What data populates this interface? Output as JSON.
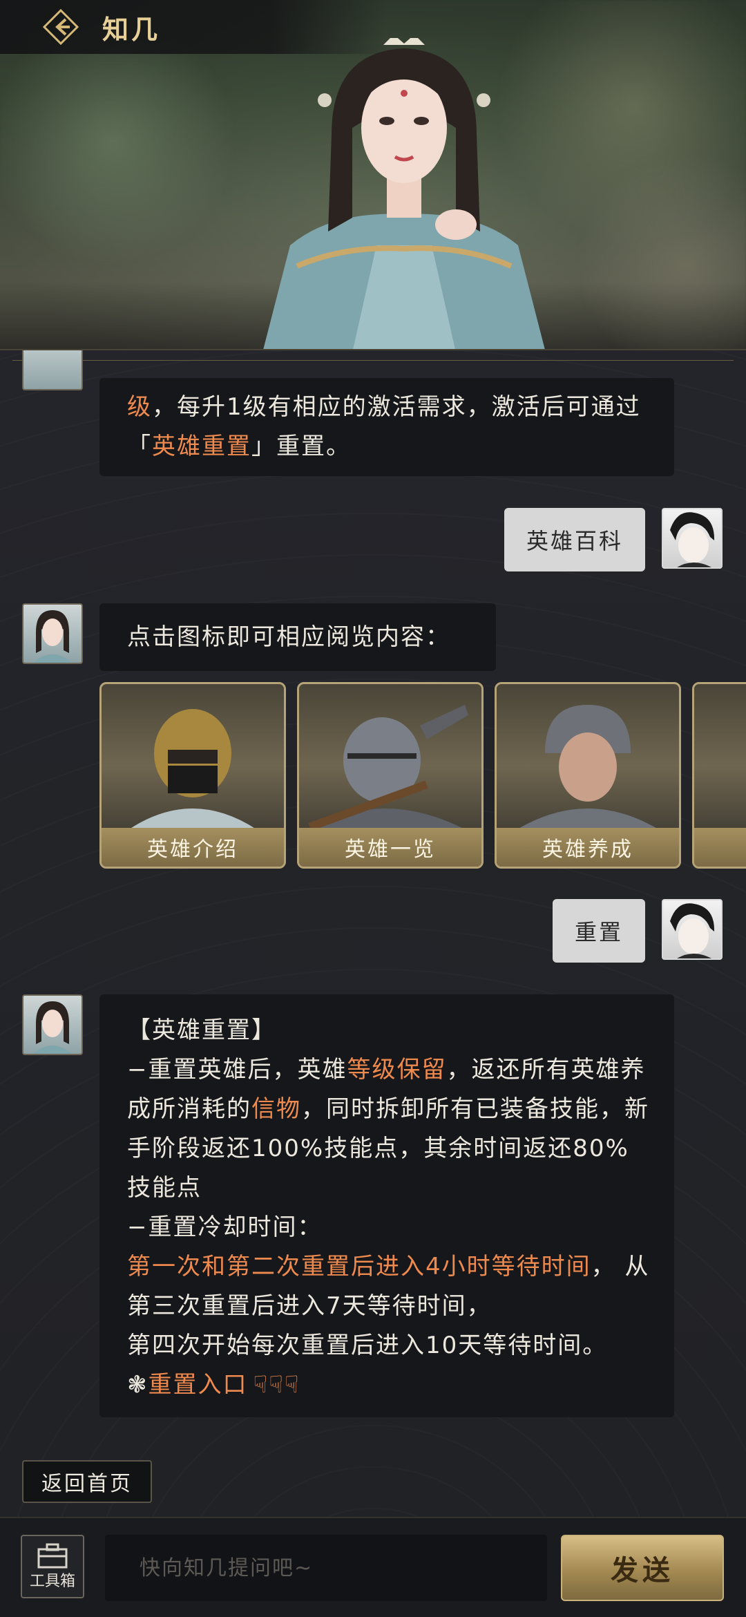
{
  "header": {
    "title": "知几",
    "back_icon": "back-arrow-icon"
  },
  "chat": {
    "bot_msg_1": {
      "parts": [
        {
          "text": "级",
          "hl": true
        },
        {
          "text": "，每升1级有相应的激活需求，激活后可通过「",
          "hl": false
        },
        {
          "text": "英雄重置",
          "hl": true
        },
        {
          "text": "」重置。",
          "hl": false
        }
      ]
    },
    "user_msg_1": "英雄百科",
    "bot_msg_2": "点击图标即可相应阅览内容：",
    "cards": [
      {
        "label": "英雄介绍"
      },
      {
        "label": "英雄一览"
      },
      {
        "label": "英雄养成"
      }
    ],
    "user_msg_2": "重置",
    "bot_msg_3": {
      "heading": "【英雄重置】",
      "line1_a": "−重置英雄后，英雄",
      "line1_hl": "等级保留",
      "line1_b": "，返还所有英雄养成所消耗的",
      "line1_hl2": "信物",
      "line1_c": "，同时拆卸所有已装备技能，新手阶段返还100%技能点，其余时间返还80%技能点",
      "line2": "−重置冷却时间：",
      "line3_hl": "第一次和第二次重置后进入4小时等待时间",
      "line3_b": "， 从第三次重置后进入7天等待时间，",
      "line4": "第四次开始每次重置后进入10天等待时间。",
      "link_prefix": "❃",
      "link_text": "重置入口",
      "link_icons": "☟☟☟"
    }
  },
  "home_button": "返回首页",
  "bottom": {
    "toolbox_label": "工具箱",
    "input_placeholder": "快向知几提问吧~",
    "send_label": "发送"
  },
  "colors": {
    "highlight": "#ef8a4f",
    "title_gold": "#e7cf98",
    "panel_bg": "#212226"
  }
}
